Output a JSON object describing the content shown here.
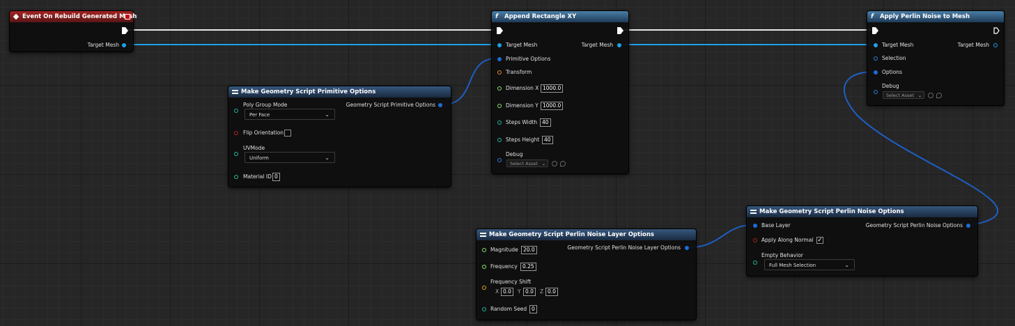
{
  "event_node": {
    "title": "Event On Rebuild Generated Mesh",
    "target_mesh_label": "Target Mesh"
  },
  "append_node": {
    "title": "Append Rectangle XY",
    "target_mesh_in": "Target Mesh",
    "target_mesh_out": "Target Mesh",
    "primitive_options": "Primitive Options",
    "transform": "Transform",
    "dimension_x_label": "Dimension X",
    "dimension_x_value": "1000.0",
    "dimension_y_label": "Dimension Y",
    "dimension_y_value": "1000.0",
    "steps_width_label": "Steps Width",
    "steps_width_value": "40",
    "steps_height_label": "Steps Height",
    "steps_height_value": "40",
    "debug_label": "Debug",
    "debug_select": "Select Asset"
  },
  "perlin_node": {
    "title": "Apply Perlin Noise to Mesh",
    "target_mesh_in": "Target Mesh",
    "target_mesh_out": "Target Mesh",
    "selection": "Selection",
    "options": "Options",
    "debug_label": "Debug",
    "debug_select": "Select Asset"
  },
  "primitive_options_node": {
    "title": "Make Geometry Script Primitive Options",
    "poly_group_mode_label": "Poly Group Mode",
    "poly_group_mode_value": "Per Face",
    "flip_orientation_label": "Flip Orientation",
    "uv_mode_label": "UVMode",
    "uv_mode_value": "Uniform",
    "material_id_label": "Material ID",
    "material_id_value": "0",
    "output_label": "Geometry Script Primitive Options"
  },
  "noise_layer_node": {
    "title": "Make Geometry Script Perlin Noise Layer Options",
    "magnitude_label": "Magnitude",
    "magnitude_value": "20.0",
    "frequency_label": "Frequency",
    "frequency_value": "0.25",
    "frequency_shift_label": "Frequency Shift",
    "x_label": "X",
    "x_value": "0.0",
    "y_label": "Y",
    "y_value": "0.0",
    "z_label": "Z",
    "z_value": "0.0",
    "random_seed_label": "Random Seed",
    "random_seed_value": "0",
    "output_label": "Geometry Script Perlin Noise Layer Options"
  },
  "noise_options_node": {
    "title": "Make Geometry Script Perlin Noise Options",
    "base_layer_label": "Base Layer",
    "apply_along_normal_label": "Apply Along Normal",
    "apply_along_normal_checked": "✓",
    "empty_behavior_label": "Empty Behavior",
    "empty_behavior_value": "Full Mesh Selection",
    "output_label": "Geometry Script Perlin Noise Options"
  },
  "colors": {
    "exec_wire": "#e8e8e8",
    "mesh_wire": "#1ea1e8",
    "struct_wire": "#1e5fc4",
    "event_header": "#a52323",
    "function_header": "#4a7ea8",
    "make_header": "#36577e"
  },
  "icons": {
    "event": "event-diamond-icon",
    "function": "function-f-icon",
    "make": "make-struct-icon",
    "exec": "exec-arrow-icon",
    "dropdown": "chevron-down-icon"
  }
}
